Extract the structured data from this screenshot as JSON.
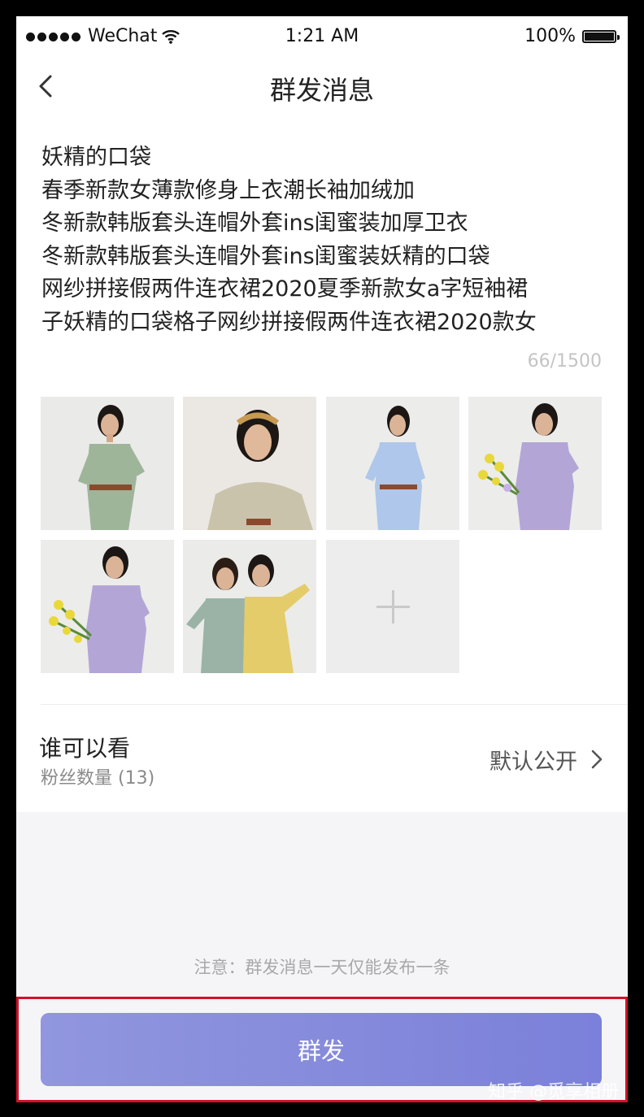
{
  "status_bar": {
    "carrier": "WeChat",
    "time": "1:21 AM",
    "battery": "100%"
  },
  "nav": {
    "title": "群发消息"
  },
  "message": {
    "text": "妖精的口袋\n春季新款女薄款修身上衣潮长袖加绒加\n冬新款韩版套头连帽外套ins闺蜜装加厚卫衣\n冬新款韩版套头连帽外套ins闺蜜装妖精的口袋\n网纱拼接假两件连衣裙2020夏季新款女a字短袖裙\n子妖精的口袋格子网纱拼接假两件连衣裙2020款女",
    "counter": "66/1500"
  },
  "photos": [
    {
      "desc": "sage green shirt dress with brown belt"
    },
    {
      "desc": "beige dress with floral headband"
    },
    {
      "desc": "light blue shirt dress with belt"
    },
    {
      "desc": "lavender floral dress with yellow flowers"
    },
    {
      "desc": "lavender floral dress with yellow flowers"
    },
    {
      "desc": "two women in green and yellow floral dresses"
    }
  ],
  "visibility": {
    "label": "谁可以看",
    "sub": "粉丝数量 (13)",
    "value": "默认公开"
  },
  "note": "注意：群发消息一天仅能发布一条",
  "send_button": "群发",
  "watermark": "知乎 @觅享相册",
  "colors": {
    "button_start": "#9196de",
    "button_end": "#7b80da",
    "highlight_border": "#d2112a"
  }
}
